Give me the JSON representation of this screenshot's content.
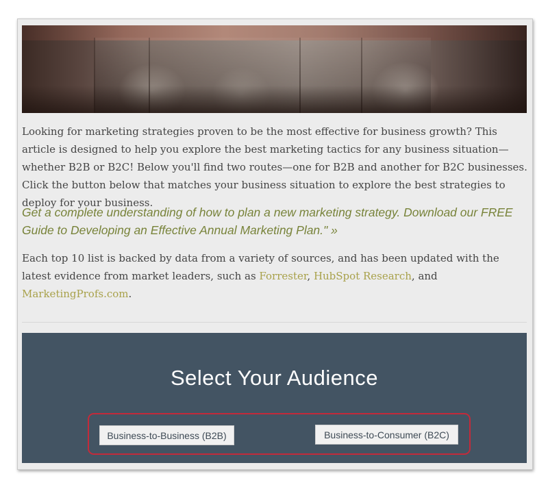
{
  "article": {
    "intro": "Looking for marketing strategies proven to be the most effective for business growth? This article is designed to help you explore the best marketing tactics for any business situation—whether B2B or B2C! Below you'll find two routes—one for B2B and another for B2C businesses. Click the button below that matches your business situation to explore the best strategies to deploy for your business.",
    "cta": "Get a complete understanding of how to plan a new marketing strategy. Download our FREE Guide to Developing an Effective Annual Marketing Plan.\" »",
    "sources": {
      "prefix": "Each top 10 list is backed by data from a variety of sources, and has been updated with the latest evidence from market leaders, such as ",
      "links": [
        "Forrester",
        "HubSpot Research",
        "MarketingProfs.com"
      ],
      "sep1": ", ",
      "sep2": ", and ",
      "suffix": "."
    }
  },
  "audience": {
    "title": "Select Your Audience",
    "b2b_label": "Business-to-Business (B2B)",
    "b2c_label": "Business-to-Consumer (B2C)"
  },
  "colors": {
    "body_text": "#444444",
    "cta_text": "#78833a",
    "link_text": "#a8a14a",
    "audience_bg": "#435463",
    "highlight_border": "#c42a3a"
  }
}
